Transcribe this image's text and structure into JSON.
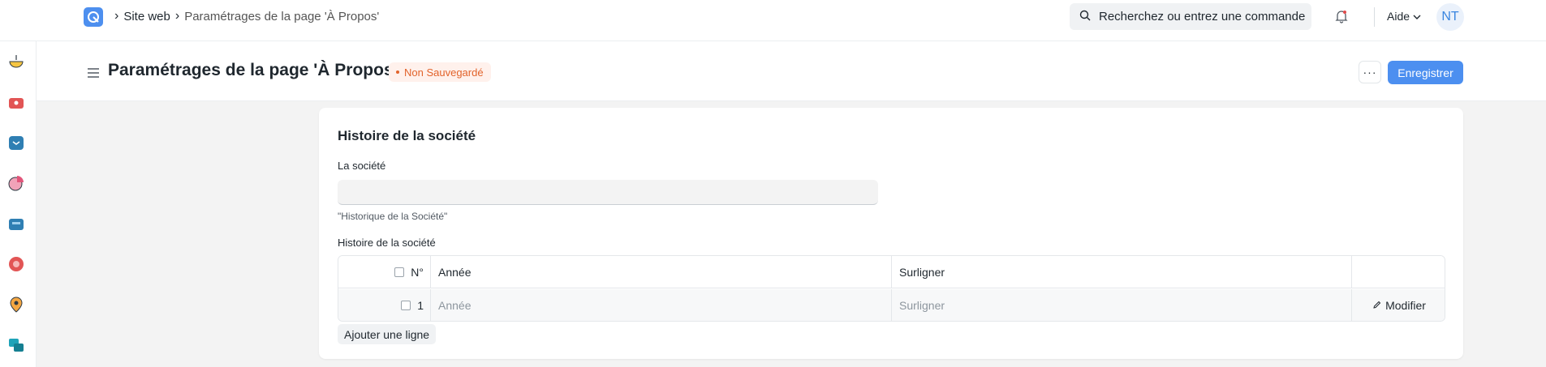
{
  "topbar": {
    "breadcrumbs": [
      "Site web",
      "Paramétrages de la page 'À Propos'"
    ],
    "search_placeholder": "Recherchez ou entrez une commande",
    "help_label": "Aide",
    "avatar_initials": "NT"
  },
  "page": {
    "title": "Paramétrages de la page 'À Propos'",
    "status_badge": "Non Sauvegardé",
    "more_label": "···",
    "save_label": "Enregistrer"
  },
  "section": {
    "title": "Histoire de la société",
    "field_label": "La société",
    "field_value": "",
    "field_description": "\"Historique de la Société\"",
    "table_label": "Histoire de la société",
    "columns": [
      "N°",
      "Année",
      "Surligner"
    ],
    "rows": [
      {
        "no": "1",
        "year_placeholder": "Année",
        "highlight_placeholder": "Surligner",
        "edit_label": "Modifier"
      }
    ],
    "add_row_label": "Ajouter une ligne"
  },
  "colors": {
    "primary": "#4c8ff0",
    "badge_text": "#e2632b",
    "badge_bg": "#fff1ec"
  },
  "sidebar_icons": [
    "bowl-icon",
    "toolbox-icon",
    "box-icon",
    "pie-chart-icon",
    "briefcase-icon",
    "support-icon",
    "location-pin-icon",
    "stack-icon"
  ]
}
